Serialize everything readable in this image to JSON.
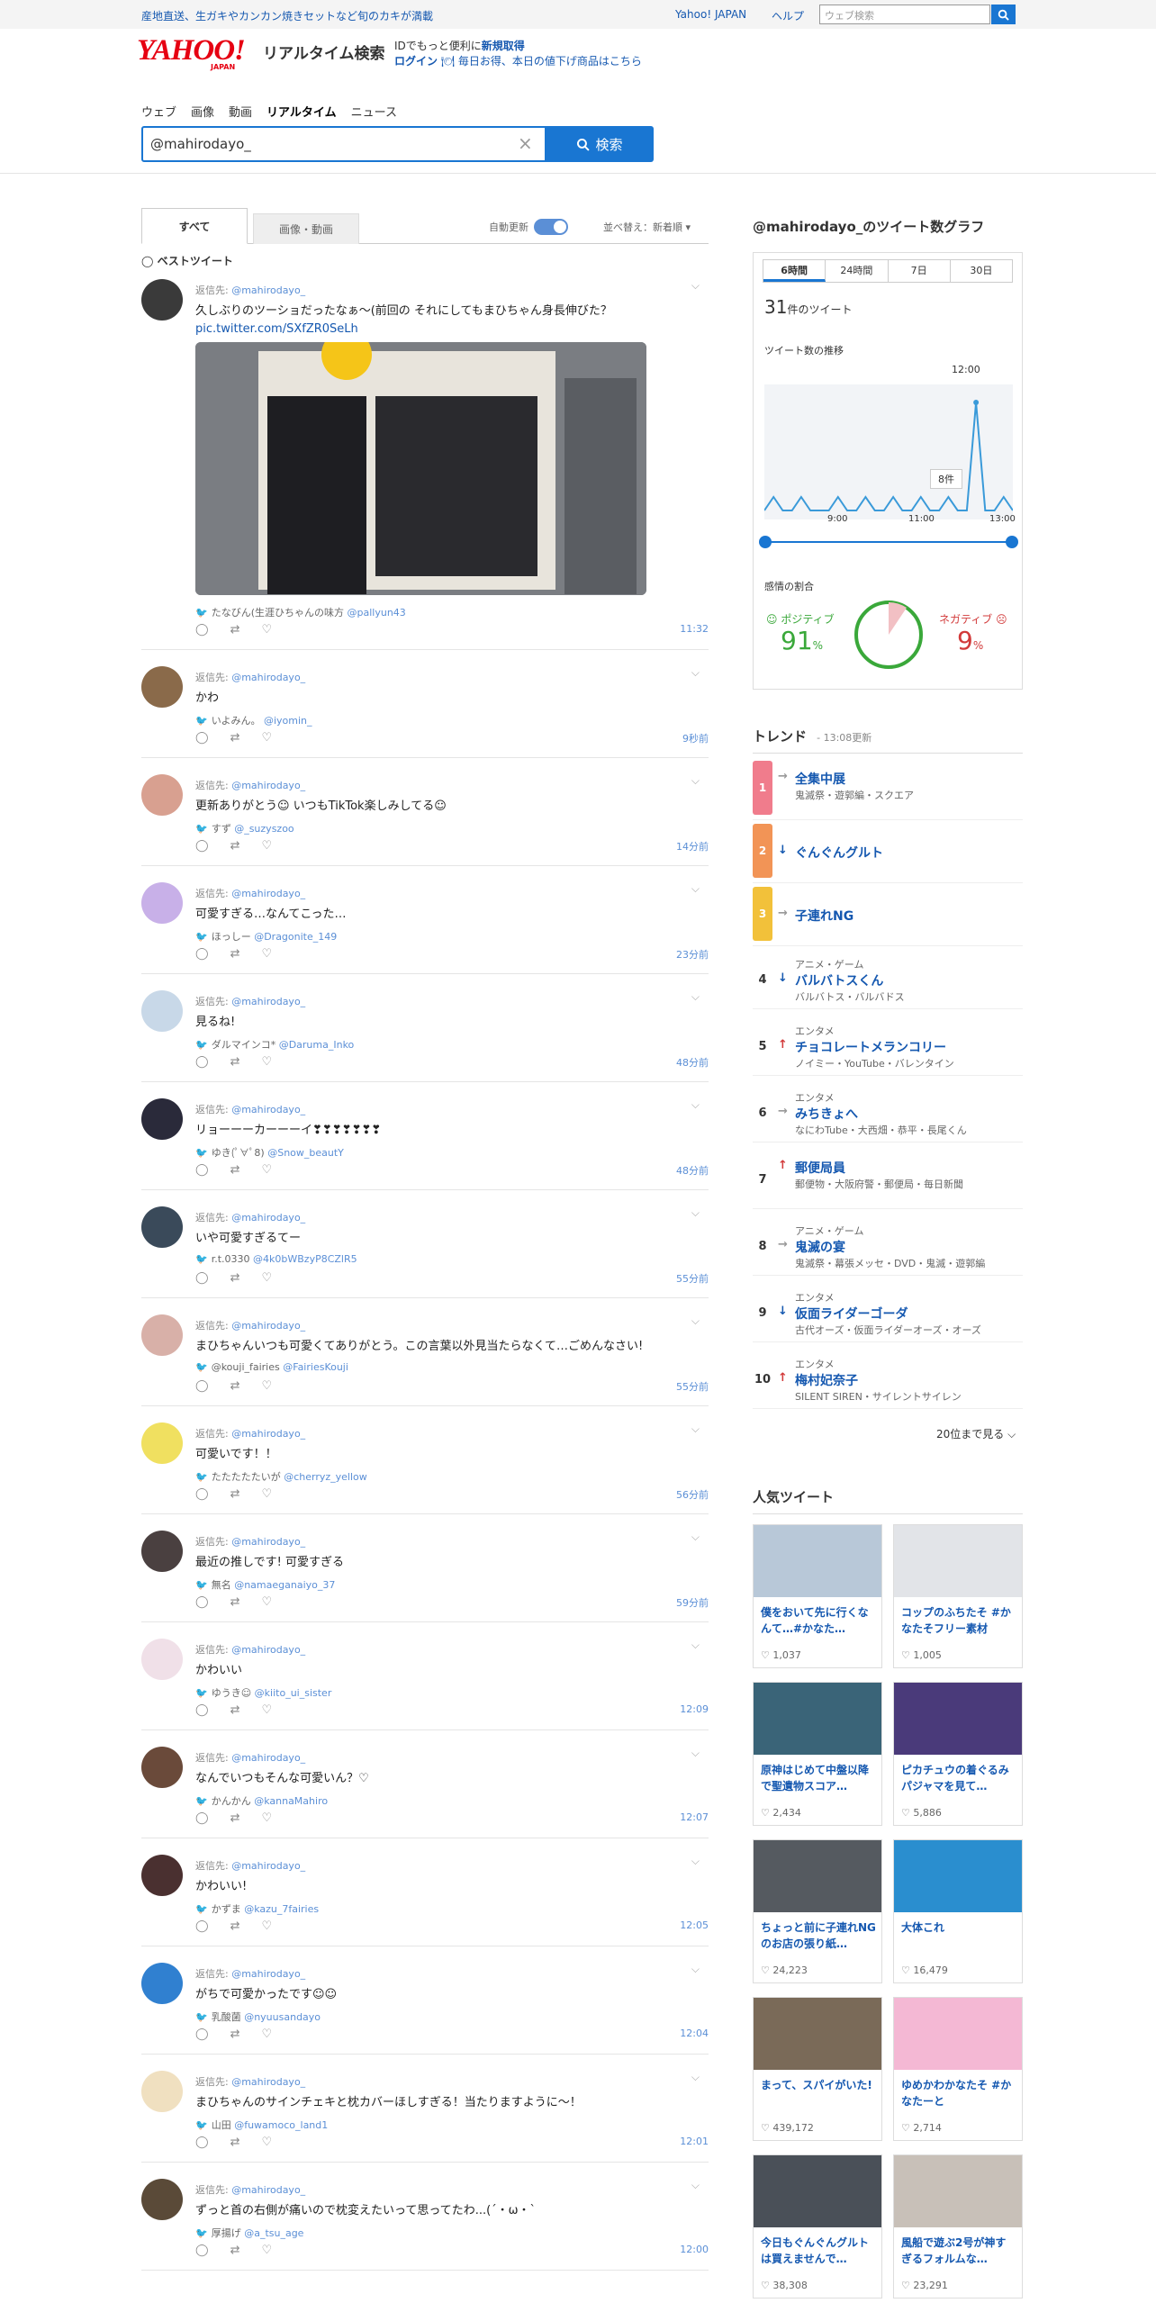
{
  "topbar": {
    "promo": "産地直送、生ガキやカンカン焼きセットなど旬のカキが満載",
    "yj": "Yahoo! JAPAN",
    "help": "ヘルプ",
    "search_placeholder": "ウェブ検索"
  },
  "logo": {
    "text": "YAHOO!",
    "sub": "JAPAN",
    "service": "リアルタイム検索"
  },
  "idpromo": {
    "line1a": "IDでもっと便利に",
    "line1b": "新規取得",
    "line2a": "ログイン",
    "line2b": "🍽 毎日お得、本日の値下げ商品はこちら"
  },
  "vertical_nav": [
    "ウェブ",
    "画像",
    "動画",
    "リアルタイム",
    "ニュース"
  ],
  "query": {
    "value": "@mahirodayo_",
    "clear": "×",
    "button": "検索"
  },
  "tabs": {
    "all": "すべて",
    "media": "画像・動画",
    "auto": "自動更新",
    "sort": "並べ替え：新着順 ▾"
  },
  "best_label": "ベストツイート",
  "reply_prefix": "返信先:",
  "reply_to": "@mahirodayo_",
  "tweets": [
    {
      "text": "久しぶりのツーショだったなぁ〜(前回の それにしてもまひちゃん身長伸びた？",
      "link": "pic.twitter.com/SXfZR0SeLh",
      "name": "たなびん(生涯ひちゃんの味方",
      "handle": "@pallyun43",
      "time": "11:32"
    },
    {
      "text": "かわ",
      "name": "いよみん。",
      "handle": "@iyomin_",
      "time": "9秒前"
    },
    {
      "text": "更新ありがとう☺ いつもTikTok楽しみしてる☺",
      "name": "すず",
      "handle": "@_suzyszoo",
      "time": "14分前"
    },
    {
      "text": "可愛すぎる…なんてこった…",
      "name": "ほっしー",
      "handle": "@Dragonite_149",
      "time": "23分前"
    },
    {
      "text": "見るね!",
      "name": "ダルマインコ* ",
      "handle": "@Daruma_Inko",
      "time": "48分前"
    },
    {
      "text": "リョーーーカーーーイ❣❣❣❣❣❣❣",
      "name": "ゆき(ﾟ∀ﾟ8)",
      "handle": "@Snow_beautY",
      "time": "48分前"
    },
    {
      "text": "いや可愛すぎるてー",
      "name": "r.t.0330",
      "handle": "@4k0bWBzyP8CZlR5",
      "time": "55分前"
    },
    {
      "text": "まひちゃんいつも可愛くてありがとう。この言葉以外見当たらなくて…ごめんなさい!",
      "name": "@kouji_fairies",
      "handle": "@FairiesKouji",
      "time": "55分前"
    },
    {
      "text": "可愛いです！！",
      "name": "たたたたたいが",
      "handle": "@cherryz_yellow",
      "time": "56分前"
    },
    {
      "text": "最近の推しです! 可愛すぎる",
      "name": "無名",
      "handle": "@namaeganaiyo_37",
      "time": "59分前"
    },
    {
      "text": "かわいい",
      "name": "ゆうき☺",
      "handle": "@kiito_ui_sister",
      "time": "12:09"
    },
    {
      "text": "なんでいつもそんな可愛いん？♡",
      "name": "かんかん",
      "handle": "@kannaMahiro",
      "time": "12:07"
    },
    {
      "text": "かわいい!",
      "name": "かずま",
      "handle": "@kazu_7fairies",
      "time": "12:05"
    },
    {
      "text": "がちで可愛かったです☺☺",
      "name": "乳酸菌",
      "handle": "@nyuusandayo",
      "time": "12:04"
    },
    {
      "text": "まひちゃんのサインチェキと枕カバーほしすぎる！当たりますように～！",
      "name": "山田",
      "handle": "@fuwamoco_land1",
      "time": "12:01"
    },
    {
      "text": "ずっと首の右側が痛いので枕変えたいって思ってたわ...(´・ω・`",
      "name": "厚揚げ",
      "handle": "@a_tsu_age",
      "time": "12:00"
    }
  ],
  "graph": {
    "title": "@mahirodayo_のツイート数グラフ",
    "tabs": [
      "6時間",
      "24時間",
      "7日",
      "30日"
    ],
    "count": "31",
    "count_suffix": "件のツイート",
    "trend_label": "ツイート数の推移",
    "peak_time": "12:00",
    "peak_label": "8件",
    "x_ticks": [
      "9:00",
      "11:00",
      "13:00"
    ],
    "series": [
      0,
      1,
      0,
      0,
      1,
      0,
      0,
      0,
      1,
      0,
      0,
      1,
      0,
      0,
      1,
      0,
      0,
      1,
      0,
      0,
      1,
      0,
      0,
      8,
      0,
      0,
      1,
      0
    ],
    "sentiment_label": "感情の割合",
    "pos_label": "ポジティブ",
    "pos": "91",
    "neg_label": "ネガティブ",
    "neg": "9",
    "pct": "%"
  },
  "trends": {
    "title": "トレンド",
    "updated": "13:08更新",
    "more": "20位まで見る ⌵",
    "items": [
      {
        "rank": "1",
        "arrow": "→",
        "cat": "",
        "name": "全集中展",
        "sub": "鬼滅祭・遊郭編・スクエア",
        "color": "#f07c8c"
      },
      {
        "rank": "2",
        "arrow": "↓",
        "cat": "",
        "name": "ぐんぐんグルト",
        "sub": "",
        "color": "#f29456"
      },
      {
        "rank": "3",
        "arrow": "→",
        "cat": "",
        "name": "子連れNG",
        "sub": "",
        "color": "#f2c13a"
      },
      {
        "rank": "4",
        "arrow": "↓",
        "cat": "アニメ・ゲーム",
        "name": "バルバトスくん",
        "sub": "バルバトス・バルバドス",
        "color": ""
      },
      {
        "rank": "5",
        "arrow": "↑",
        "cat": "エンタメ",
        "name": "チョコレートメランコリー",
        "sub": "ノイミー・YouTube・バレンタイン",
        "color": ""
      },
      {
        "rank": "6",
        "arrow": "→",
        "cat": "エンタメ",
        "name": "みちきょへ",
        "sub": "なにわTube・大西畑・恭平・長尾くん",
        "color": ""
      },
      {
        "rank": "7",
        "arrow": "↑",
        "cat": "",
        "name": "郵便局員",
        "sub": "郵便物・大阪府警・郵便局・毎日新聞",
        "color": ""
      },
      {
        "rank": "8",
        "arrow": "→",
        "cat": "アニメ・ゲーム",
        "name": "鬼滅の宴",
        "sub": "鬼滅祭・幕張メッセ・DVD・鬼滅・遊郭編",
        "color": ""
      },
      {
        "rank": "9",
        "arrow": "↓",
        "cat": "エンタメ",
        "name": "仮面ライダーゴーダ",
        "sub": "古代オーズ・仮面ライダーオーズ・オーズ",
        "color": ""
      },
      {
        "rank": "10",
        "arrow": "↑",
        "cat": "エンタメ",
        "name": "梅村妃奈子",
        "sub": "SILENT SIREN・サイレントサイレン",
        "color": ""
      }
    ]
  },
  "popular": {
    "title": "人気ツイート",
    "items": [
      {
        "text": "僕をおいて先に行くなんて…#かなた…",
        "likes": "1,037",
        "bg": "#b8c8d8"
      },
      {
        "text": "コップのふちたそ #かなたそフリー素材",
        "likes": "1,005",
        "bg": "#e2e4e8"
      },
      {
        "text": "原神はじめて中盤以降で聖遺物スコア…",
        "likes": "2,434",
        "bg": "#3a6478"
      },
      {
        "text": "ピカチュウの着ぐるみパジャマを見て…",
        "likes": "5,886",
        "bg": "#4a3a7a"
      },
      {
        "text": "ちょっと前に子連れNGのお店の張り紙…",
        "likes": "24,223",
        "bg": "#555a60"
      },
      {
        "text": "大体これ",
        "likes": "16,479",
        "bg": "#2a8ecf"
      },
      {
        "text": "まって、スパイがいた!",
        "likes": "439,172",
        "bg": "#7a6a58"
      },
      {
        "text": "ゆめかわかなたそ #かなたーと",
        "likes": "2,714",
        "bg": "#f4b8d4"
      },
      {
        "text": "今日もぐんぐんグルトは買えませんで…",
        "likes": "38,308",
        "bg": "#4a5058"
      },
      {
        "text": "風船で遊ぶ2号が神すぎるフォルムな…",
        "likes": "23,291",
        "bg": "#c8c0b8"
      }
    ]
  }
}
